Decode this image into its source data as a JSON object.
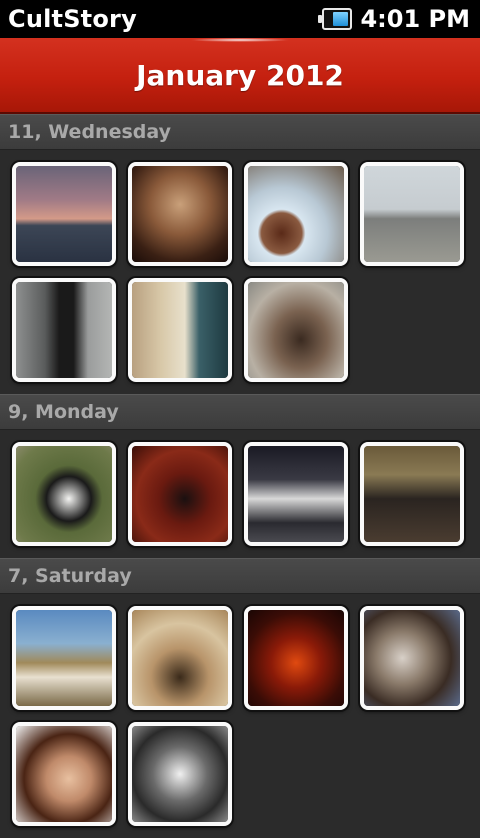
{
  "status_bar": {
    "app_title": "CultStory",
    "time": "4:01 PM",
    "battery_level": 0.7
  },
  "header": {
    "title": "January 2012"
  },
  "sections": [
    {
      "day_label": "11, Wednesday",
      "photos": [
        {
          "name": "sunset-pier-photo",
          "bg": "linear-gradient(#6a6478 0%, #a07a86 35%, #d49a88 55%, #3c4656 62%, #2a3242 100%)"
        },
        {
          "name": "statue-face-photo",
          "bg": "radial-gradient(circle at 50% 40%, #c9a07a 0%, #8a5a3a 40%, #3a2014 75%, #1a0c08 100%)"
        },
        {
          "name": "tea-cup-photo",
          "bg": "radial-gradient(circle at 35% 70%, #5a2a18 0%, #8a5a40 22%, #d8e6f0 26%, #b8c8d4 50%, #6a5a4a 100%)"
        },
        {
          "name": "airport-tarmac-photo",
          "bg": "linear-gradient(#cfd6da 0%, #c6ccd0 45%, #7c7e7c 55%, #9a9a92 100%)"
        },
        {
          "name": "person-back-photo",
          "bg": "linear-gradient(90deg, #8e9090 0%, #5a5c5c 30%, #1a1a1a 45%, #1a1a1a 60%, #9a9c9c 75%, #b4b6b4 100%)"
        },
        {
          "name": "glass-bottle-photo",
          "bg": "linear-gradient(90deg, #b8a080 0%, #d8c8a8 30%, #e8e0cc 55%, #3a6068 70%, #1e3a40 100%)"
        },
        {
          "name": "rabbit-photo",
          "bg": "radial-gradient(ellipse at 55% 60%, #3a2a20 0%, #7a6250 35%, #b8b0a4 70%, #8a8a84 100%)"
        }
      ]
    },
    {
      "day_label": "9, Monday",
      "photos": [
        {
          "name": "panda-photo",
          "bg": "radial-gradient(ellipse at 55% 55%, #f4f4f2 0%, #1a1a1a 30%, #5a6a3a 45%, #6e7a4a 80%, #8a8a6a 100%)"
        },
        {
          "name": "wallet-table-photo",
          "bg": "radial-gradient(circle at 55% 55%, #1a1010 0%, #6a1a10 35%, #8a2a18 65%, #3a0e08 100%)"
        },
        {
          "name": "night-taxi-photo",
          "bg": "linear-gradient(#1a1a24 0%, #3a3a44 35%, #d8d8d8 55%, #2a2a30 80%, #4a4a50 100%)"
        },
        {
          "name": "restaurant-people-photo",
          "bg": "linear-gradient(#6a5a3a 0%, #8a7a54 30%, #2a2420 55%, #4a3c30 100%)"
        }
      ]
    },
    {
      "day_label": "7, Saturday",
      "photos": [
        {
          "name": "zebras-photo",
          "bg": "linear-gradient(#5a8ac0 0%, #8ab0d0 35%, #a08a5a 55%, #e8e0d0 70%, #7a6a48 100%)"
        },
        {
          "name": "coffee-cup-photo",
          "bg": "radial-gradient(circle at 50% 70%, #3a2a1a 0%, #b8946a 35%, #d8c4a0 65%, #a8865a 100%)"
        },
        {
          "name": "tea-glass-photo",
          "bg": "radial-gradient(circle at 50% 55%, #e04a10 0%, #8a1a08 35%, #3a0c06 70%, #1a0604 100%)"
        },
        {
          "name": "dog-face-photo",
          "bg": "radial-gradient(circle at 40% 50%, #d8d0c8 0%, #8a7a6a 35%, #3a2c24 65%, #5a6a8a 100%)"
        },
        {
          "name": "smiling-woman-photo",
          "bg": "radial-gradient(ellipse at 55% 55%, #e8c0a0 0%, #c08a6a 30%, #4a2414 60%, #f0f0f0 100%)"
        },
        {
          "name": "puppy-bw-photo",
          "bg": "radial-gradient(circle at 50% 50%, #f0f0f0 0%, #6a6a6a 40%, #2a2a2a 70%, #8a8a8a 100%)"
        }
      ]
    }
  ]
}
